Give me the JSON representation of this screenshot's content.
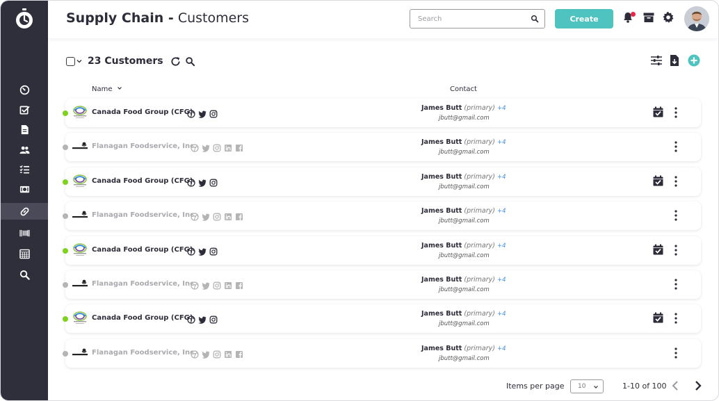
{
  "header": {
    "title_bold": "Supply Chain -",
    "title_rest": "Customers",
    "search_placeholder": "Search",
    "create_label": "Create"
  },
  "toolbar": {
    "count_label": "23 Customers"
  },
  "columns": {
    "name": "Name",
    "contact": "Contact"
  },
  "colors": {
    "accent": "#4fc3c0",
    "sidebar": "#2f2f3c",
    "active_dot": "#7ed321",
    "inactive_dot": "#b4b4b4",
    "link": "#3f8fe0",
    "notification": "#e8284a"
  },
  "rows": [
    {
      "name": "Canada Food Group (CFG)",
      "active": true,
      "socials": [
        "globe-icon",
        "twitter-icon",
        "instagram-icon"
      ],
      "contact_name": "James Butt",
      "contact_role": "(primary)",
      "contact_more": "+4",
      "email": "jbutt@gmail.com",
      "calendar": true
    },
    {
      "name": "Flanagan Foodservice, Inc.",
      "active": false,
      "socials": [
        "globe-icon",
        "twitter-icon",
        "instagram-icon",
        "linkedin-icon",
        "facebook-icon"
      ],
      "contact_name": "James Butt",
      "contact_role": "(primary)",
      "contact_more": "+4",
      "email": "jbutt@gmail.com",
      "calendar": false
    },
    {
      "name": "Canada Food Group (CFG)",
      "active": true,
      "socials": [
        "globe-icon",
        "twitter-icon",
        "instagram-icon"
      ],
      "contact_name": "James Butt",
      "contact_role": "(primary)",
      "contact_more": "+4",
      "email": "jbutt@gmail.com",
      "calendar": true
    },
    {
      "name": "Flanagan Foodservice, Inc.",
      "active": false,
      "socials": [
        "globe-icon",
        "twitter-icon",
        "instagram-icon",
        "linkedin-icon",
        "facebook-icon"
      ],
      "contact_name": "James Butt",
      "contact_role": "(primary)",
      "contact_more": "+4",
      "email": "jbutt@gmail.com",
      "calendar": false
    },
    {
      "name": "Canada Food Group (CFG)",
      "active": true,
      "socials": [
        "globe-icon",
        "twitter-icon",
        "instagram-icon"
      ],
      "contact_name": "James Butt",
      "contact_role": "(primary)",
      "contact_more": "+4",
      "email": "jbutt@gmail.com",
      "calendar": true
    },
    {
      "name": "Flanagan Foodservice, Inc.",
      "active": false,
      "socials": [
        "globe-icon",
        "twitter-icon",
        "instagram-icon",
        "linkedin-icon",
        "facebook-icon"
      ],
      "contact_name": "James Butt",
      "contact_role": "(primary)",
      "contact_more": "+4",
      "email": "jbutt@gmail.com",
      "calendar": false
    },
    {
      "name": "Canada Food Group (CFG)",
      "active": true,
      "socials": [
        "globe-icon",
        "twitter-icon",
        "instagram-icon"
      ],
      "contact_name": "James Butt",
      "contact_role": "(primary)",
      "contact_more": "+4",
      "email": "jbutt@gmail.com",
      "calendar": true
    },
    {
      "name": "Flanagan Foodservice, Inc.",
      "active": false,
      "socials": [
        "globe-icon",
        "twitter-icon",
        "instagram-icon",
        "linkedin-icon",
        "facebook-icon"
      ],
      "contact_name": "James Butt",
      "contact_role": "(primary)",
      "contact_more": "+4",
      "email": "jbutt@gmail.com",
      "calendar": false
    }
  ],
  "pagination": {
    "items_per_page_label": "Items per page",
    "items_per_page_value": "10",
    "range_label": "1-10 of 100"
  },
  "sidebar": {
    "items": [
      "dashboard-icon",
      "checklist-icon",
      "document-icon",
      "users-icon",
      "list-icon",
      "money-icon",
      "link-icon",
      "barcode-icon",
      "calendar-grid-icon",
      "search-icon"
    ],
    "active_index": 6
  }
}
